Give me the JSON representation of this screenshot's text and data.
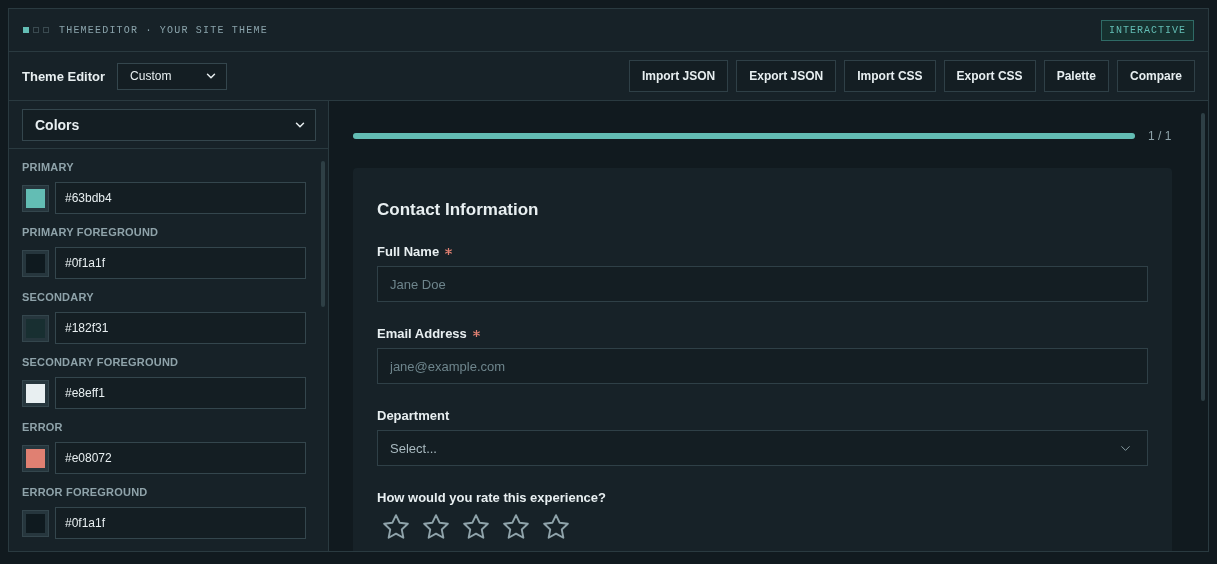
{
  "titlebar": {
    "title": "THEMEEDITOR · YOUR SITE THEME",
    "badge": "INTERACTIVE"
  },
  "toolbar": {
    "title": "Theme Editor",
    "preset": {
      "value": "Custom"
    },
    "buttons": [
      "Import JSON",
      "Export JSON",
      "Import CSS",
      "Export CSS",
      "Palette",
      "Compare"
    ]
  },
  "sidebar": {
    "section": {
      "value": "Colors"
    },
    "colors": [
      {
        "label": "PRIMARY",
        "value": "#63bdb4",
        "color": "#63bdb4"
      },
      {
        "label": "PRIMARY FOREGROUND",
        "value": "#0f1a1f",
        "color": "#0f1a1f"
      },
      {
        "label": "SECONDARY",
        "value": "#182f31",
        "color": "#182f31"
      },
      {
        "label": "SECONDARY FOREGROUND",
        "value": "#e8eff1",
        "color": "#e8eff1"
      },
      {
        "label": "ERROR",
        "value": "#e08072",
        "color": "#e08072"
      },
      {
        "label": "ERROR FOREGROUND",
        "value": "#0f1a1f",
        "color": "#0f1a1f"
      }
    ]
  },
  "preview": {
    "progress": {
      "level": 1,
      "reading": "1 / 1"
    },
    "form": {
      "title": "Contact Information",
      "fields": [
        {
          "kind": "text",
          "label": "Full Name",
          "required": true,
          "placeholder": "Jane Doe"
        },
        {
          "kind": "text",
          "label": "Email Address",
          "required": true,
          "placeholder": "jane@example.com"
        },
        {
          "kind": "select",
          "label": "Department",
          "required": false,
          "placeholder": "Select..."
        },
        {
          "kind": "rating",
          "label": "How would you rate this experience?",
          "required": false,
          "stars": 0
        }
      ]
    }
  }
}
